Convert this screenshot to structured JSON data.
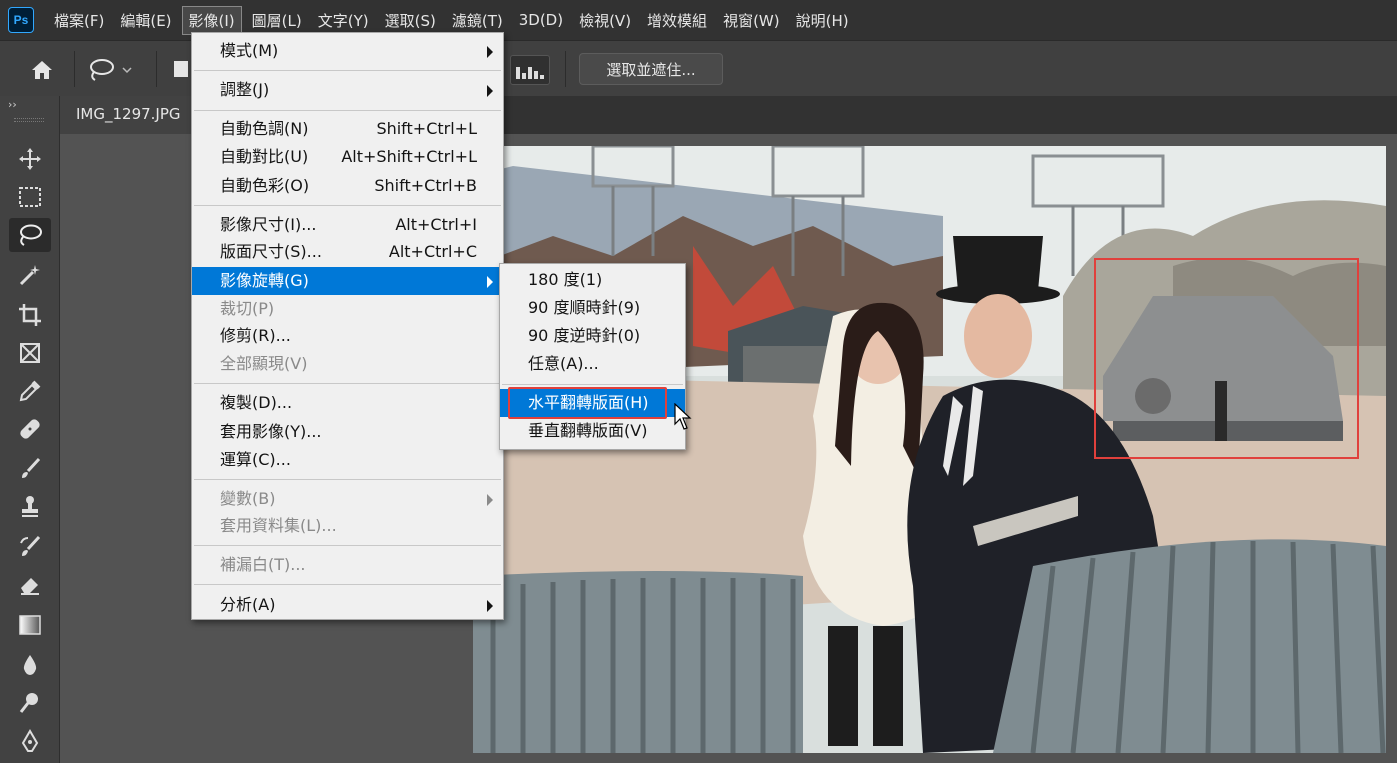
{
  "app": {
    "logo": "Ps"
  },
  "menubar": [
    "檔案(F)",
    "編輯(E)",
    "影像(I)",
    "圖層(L)",
    "文字(Y)",
    "選取(S)",
    "濾鏡(T)",
    "3D(D)",
    "檢視(V)",
    "增效模組",
    "視窗(W)",
    "說明(H)"
  ],
  "options_bar": {
    "select_and_mask": "選取並遮住..."
  },
  "toolbar": {
    "collapse": "››"
  },
  "document": {
    "tab": "IMG_1297.JPG"
  },
  "image_menu": {
    "mode": "模式(M)",
    "adjustments": "調整(J)",
    "auto_tone": {
      "label": "自動色調(N)",
      "shortcut": "Shift+Ctrl+L"
    },
    "auto_contrast": {
      "label": "自動對比(U)",
      "shortcut": "Alt+Shift+Ctrl+L"
    },
    "auto_color": {
      "label": "自動色彩(O)",
      "shortcut": "Shift+Ctrl+B"
    },
    "image_size": {
      "label": "影像尺寸(I)...",
      "shortcut": "Alt+Ctrl+I"
    },
    "canvas_size": {
      "label": "版面尺寸(S)...",
      "shortcut": "Alt+Ctrl+C"
    },
    "image_rotation": "影像旋轉(G)",
    "crop": "裁切(P)",
    "trim": "修剪(R)...",
    "reveal_all": "全部顯現(V)",
    "duplicate": "複製(D)...",
    "apply_image": "套用影像(Y)...",
    "calculations": "運算(C)...",
    "variables": "變數(B)",
    "apply_data_set": "套用資料集(L)...",
    "trap": "補漏白(T)...",
    "analysis": "分析(A)"
  },
  "rotation_submenu": {
    "rot180": "180 度(1)",
    "cw90": "90 度順時針(9)",
    "ccw90": "90 度逆時針(0)",
    "arbitrary": "任意(A)...",
    "flip_h": "水平翻轉版面(H)",
    "flip_v": "垂直翻轉版面(V)"
  },
  "colors": {
    "highlight": "#0078d7",
    "annotation": "#e0403c",
    "menu_bg": "#f0f0f0",
    "chrome": "#323232"
  }
}
